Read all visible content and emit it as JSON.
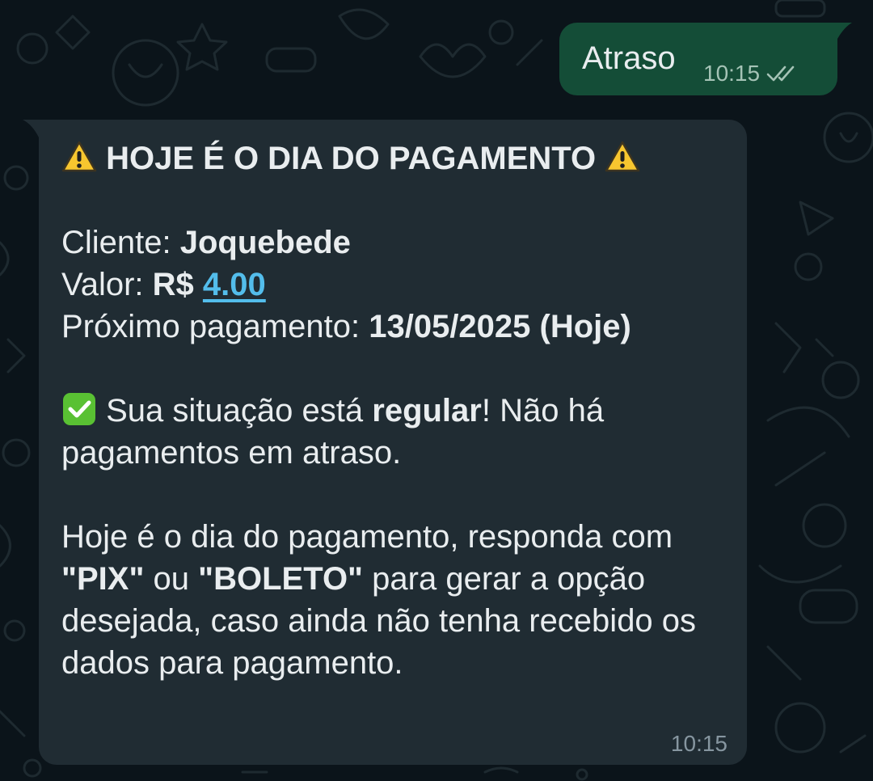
{
  "outgoing": {
    "text": "Atraso",
    "time": "10:15",
    "status_icon": "double-check-icon",
    "bubble_color": "#144d37"
  },
  "incoming": {
    "bubble_color": "#202c33",
    "link_color": "#53bdeb",
    "title_icon": "warning-icon",
    "title": "HOJE É O DIA DO PAGAMENTO",
    "client_label": "Cliente:",
    "client_value": "Joquebede",
    "amount_label": "Valor:",
    "currency": "R$",
    "amount": "4.00",
    "next_label": "Próximo pagamento:",
    "next_value": "13/05/2025 (Hoje)",
    "status_icon": "check-mark-button-icon",
    "status_pre": "Sua situação está",
    "status_bold": "regular",
    "status_post": "! Não há pagamentos em atraso.",
    "instr_1": "Hoje é o dia do pagamento, responda com",
    "instr_pix": "\"PIX\"",
    "instr_or": "ou",
    "instr_boleto": "\"BOLETO\"",
    "instr_2": "para gerar a opção desejada, caso ainda não tenha recebido os dados para pagamento.",
    "time": "10:15"
  }
}
